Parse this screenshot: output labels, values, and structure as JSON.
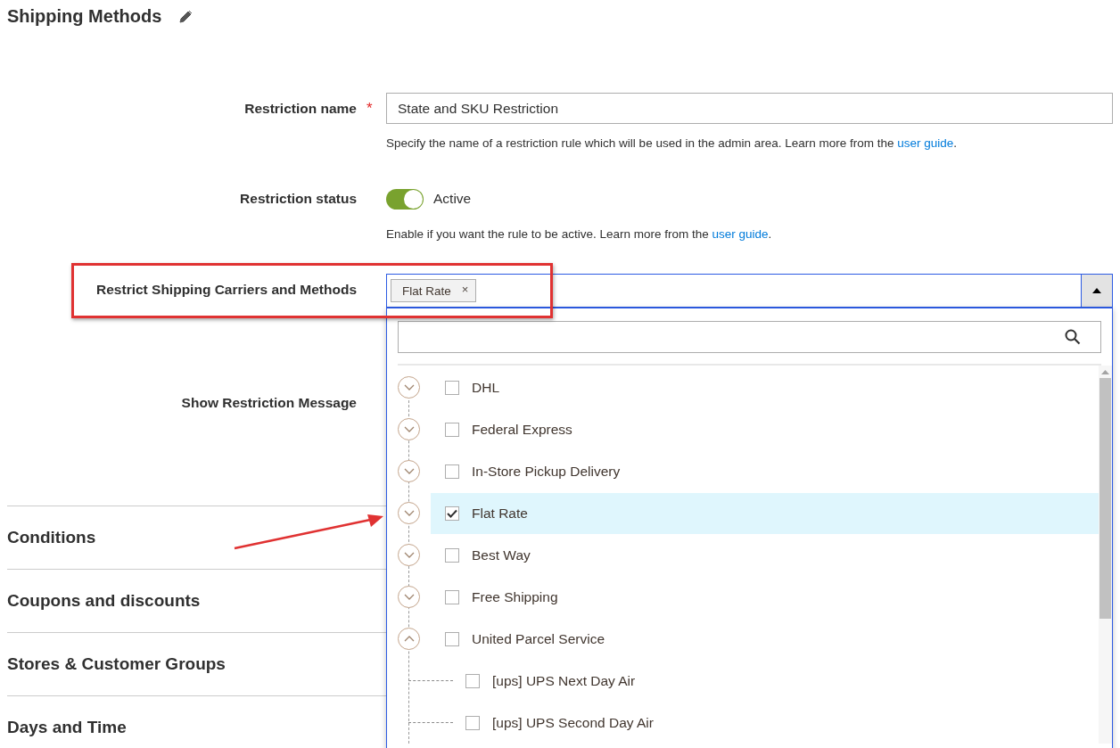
{
  "page": {
    "title": "Shipping Methods"
  },
  "fields": [
    {
      "kind": "text",
      "label": "Restriction name",
      "required_mark": "*",
      "value": "State and SKU Restriction",
      "hint": {
        "text": "Specify the name of a restriction rule which will be used in the admin area. Learn more from the ",
        "link": "user guide",
        "end": "."
      }
    },
    {
      "kind": "toggle",
      "label": "Restriction status",
      "on": true,
      "state_label": "Active",
      "hint": {
        "text": "Enable if you want the rule to be active. Learn more from the ",
        "link": "user guide",
        "end": "."
      }
    },
    {
      "kind": "multiselect",
      "label": "Restrict Shipping Carriers and Methods",
      "expanded": true,
      "chips": [
        {
          "label": "Flat Rate",
          "remove": "×"
        }
      ]
    },
    {
      "kind": "empty",
      "label": "Show Restriction Message"
    }
  ],
  "dropdown": {
    "items": [
      {
        "label": "DHL",
        "checked": false,
        "expanded": false,
        "highlighted": false
      },
      {
        "label": "Federal Express",
        "checked": false,
        "expanded": false,
        "highlighted": false
      },
      {
        "label": "In-Store Pickup Delivery",
        "checked": false,
        "expanded": false,
        "highlighted": false
      },
      {
        "label": "Flat Rate",
        "checked": true,
        "expanded": false,
        "highlighted": true
      },
      {
        "label": "Best Way",
        "checked": false,
        "expanded": false,
        "highlighted": false
      },
      {
        "label": "Free Shipping",
        "checked": false,
        "expanded": false,
        "highlighted": false
      },
      {
        "label": "United Parcel Service",
        "checked": false,
        "expanded": true,
        "highlighted": false,
        "children": [
          {
            "label": "[ups] UPS Next Day Air",
            "checked": false,
            "highlighted": false
          },
          {
            "label": "[ups] UPS Second Day Air",
            "checked": false,
            "highlighted": false
          }
        ]
      }
    ]
  },
  "sections": [
    {
      "title": "Conditions"
    },
    {
      "title": "Coupons and discounts"
    },
    {
      "title": "Stores & Customer Groups"
    },
    {
      "title": "Days and Time"
    }
  ]
}
